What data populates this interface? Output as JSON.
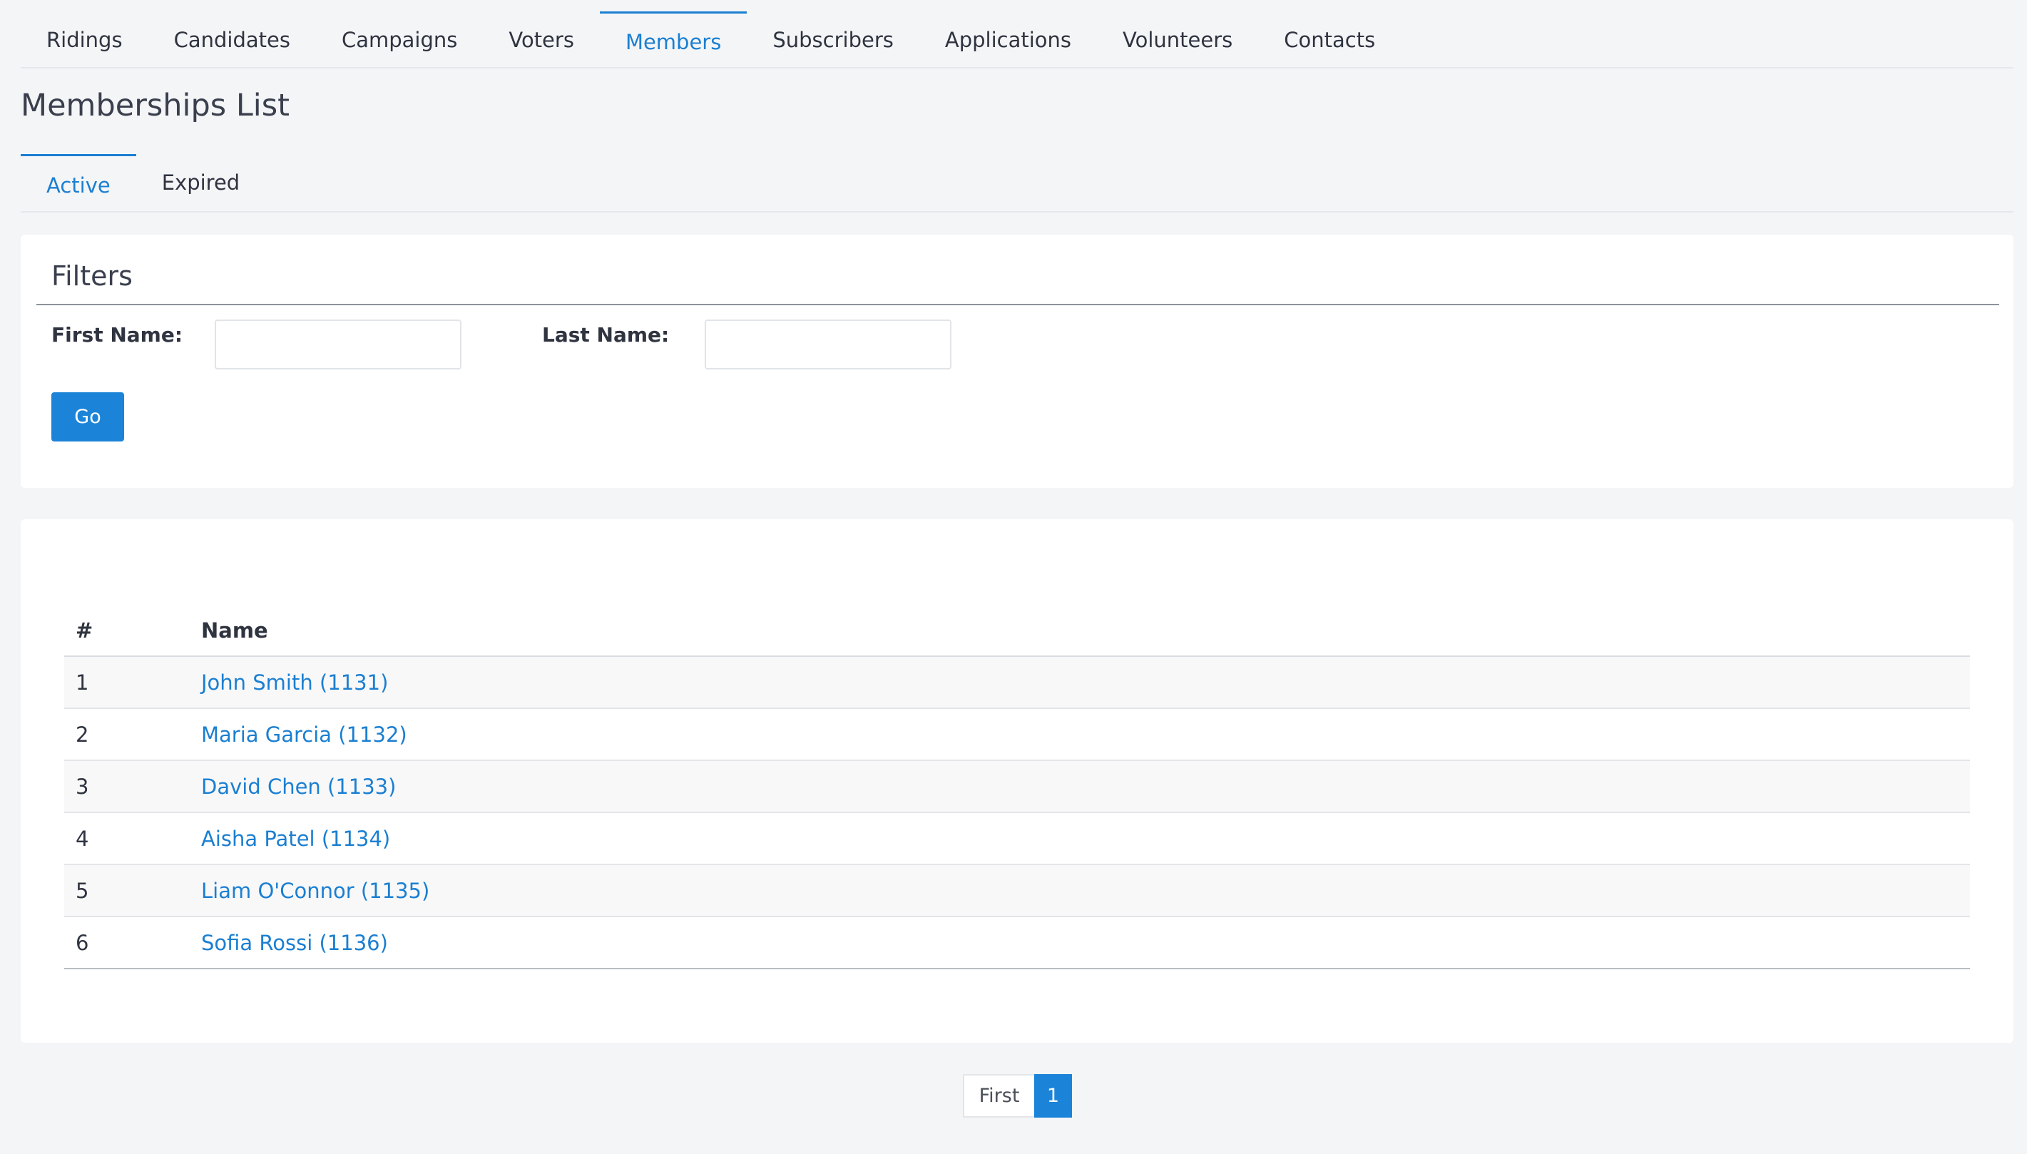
{
  "colors": {
    "accent": "#1b84d8",
    "link": "#1b7fd1",
    "background": "#f4f5f7",
    "card": "#ffffff"
  },
  "top_nav": {
    "items": [
      {
        "label": "Ridings"
      },
      {
        "label": "Candidates"
      },
      {
        "label": "Campaigns"
      },
      {
        "label": "Voters"
      },
      {
        "label": "Members",
        "active": true
      },
      {
        "label": "Subscribers"
      },
      {
        "label": "Applications"
      },
      {
        "label": "Volunteers"
      },
      {
        "label": "Contacts"
      }
    ]
  },
  "page": {
    "title": "Memberships List"
  },
  "sub_tabs": {
    "items": [
      {
        "label": "Active",
        "active": true
      },
      {
        "label": "Expired"
      }
    ]
  },
  "filters": {
    "title": "Filters",
    "first_name_label": "First Name:",
    "first_name_value": "",
    "last_name_label": "Last Name:",
    "last_name_value": "",
    "go_label": "Go"
  },
  "table": {
    "headers": {
      "number": "#",
      "name": "Name"
    },
    "rows": [
      {
        "num": "1",
        "name": "John Smith (1131)"
      },
      {
        "num": "2",
        "name": "Maria Garcia (1132)"
      },
      {
        "num": "3",
        "name": "David Chen (1133)"
      },
      {
        "num": "4",
        "name": "Aisha Patel (1134)"
      },
      {
        "num": "5",
        "name": "Liam O'Connor (1135)"
      },
      {
        "num": "6",
        "name": "Sofia Rossi (1136)"
      }
    ]
  },
  "pagination": {
    "first_label": "First",
    "current_page": "1"
  }
}
